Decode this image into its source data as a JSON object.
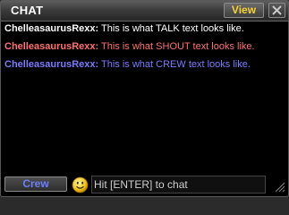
{
  "window": {
    "title": "CHAT",
    "view_label": "View"
  },
  "messages": [
    {
      "channel": "talk",
      "sender": "ChelleasaurusRexx:",
      "text": "This is what TALK text looks like."
    },
    {
      "channel": "shout",
      "sender": "ChelleasaurusRexx:",
      "text": "This is what SHOUT text looks like."
    },
    {
      "channel": "crew",
      "sender": "ChelleasaurusRexx:",
      "text": "This is what CREW text looks like."
    }
  ],
  "footer": {
    "channel_label": "Crew",
    "input_placeholder": "Hit [ENTER] to chat"
  },
  "colors": {
    "talk": "#ffffff",
    "shout": "#ff7070",
    "crew": "#7a7aff",
    "view_label": "#f4d23a"
  },
  "icons": {
    "close": "close-icon",
    "emoji": "smiley-icon",
    "resize": "resize-grip-icon"
  }
}
